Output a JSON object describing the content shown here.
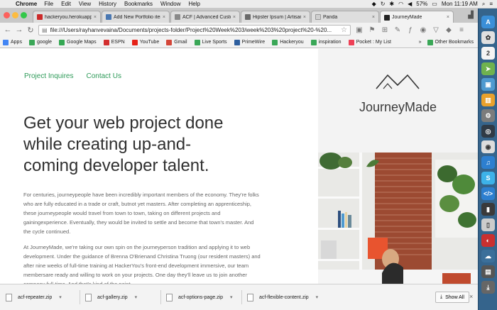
{
  "menubar": {
    "app_name": "Chrome",
    "items": [
      "File",
      "Edit",
      "View",
      "History",
      "Bookmarks",
      "Window",
      "Help"
    ],
    "battery": "57%",
    "clock": "Mon 11:19 AM"
  },
  "tabs": [
    {
      "title": "hackeryou.herokuapp.c",
      "icon_color": "#cc2a2a",
      "active": false
    },
    {
      "title": "Add New Portfolio item",
      "icon_color": "#4a78b2",
      "active": false
    },
    {
      "title": "ACF | Advanced Custom",
      "icon_color": "#8a8a8a",
      "active": false
    },
    {
      "title": "Hipster Ipsum | Artisan",
      "icon_color": "#6a6a6a",
      "active": false
    },
    {
      "title": "Panda",
      "icon_color": "#cfcfcf",
      "active": false
    },
    {
      "title": "JourneyMade",
      "icon_color": "#222222",
      "active": true
    }
  ],
  "toolbar": {
    "url": "file:///Users/rayhanvevaina/Documents/projects-folder/Project%20Week%203/week%203%20project%20-%20..."
  },
  "bookmarks": {
    "items": [
      {
        "label": "Apps",
        "icon": "apps-grid-icon",
        "color": "#4285f4"
      },
      {
        "label": "google",
        "icon": "folder-icon",
        "color": "#3aa757"
      },
      {
        "label": "Google Maps",
        "icon": "maps-pin-icon",
        "color": "#34a853"
      },
      {
        "label": "ESPN",
        "icon": "espn-icon",
        "color": "#d32f2f"
      },
      {
        "label": "YouTube",
        "icon": "youtube-icon",
        "color": "#e62117"
      },
      {
        "label": "Gmail",
        "icon": "gmail-icon",
        "color": "#d44638"
      },
      {
        "label": "Live Sports",
        "icon": "folder-icon",
        "color": "#3aa757"
      },
      {
        "label": "PrimeWire",
        "icon": "primewire-icon",
        "color": "#2d5e9e"
      },
      {
        "label": "Hackeryou",
        "icon": "folder-icon",
        "color": "#3aa757"
      },
      {
        "label": "inspiration",
        "icon": "folder-icon",
        "color": "#3aa757"
      },
      {
        "label": "Pocket : My List",
        "icon": "pocket-icon",
        "color": "#ee4056"
      }
    ],
    "overflow": "»",
    "other": "Other Bookmarks"
  },
  "page": {
    "nav": [
      "Project Inquires",
      "Contact Us"
    ],
    "headline": "Get your web project done while creating up-and-coming developer talent.",
    "paragraphs": [
      "For centuries, journeypeople have been incredibly important members of the economy. They're folks who are fully educated in a trade or craft, butnot yet masters. After completing an apprenticeship, these journeypeople would travel from town to town, taking on different projects and gainingexperience. Eventually, they would be invited to settle and become that town's master. And the cycle continued.",
      "At JourneyMade, we're taking our own spin on the journeyperson tradition and applying it to web development. Under the guidance of Brenna O'Brienand Christina Truong (our resident masters) and after nine weeks of full-time training at HackerYou's front-end development immersive, our team membersare ready and willing to work on your projects. One day they'll leave us to join another company full-time. And that's kind of the point."
    ],
    "brand": "JourneyMade"
  },
  "downloads": {
    "files": [
      "acf-repeater.zip",
      "acf-gallery.zip",
      "acf-options-page.zip",
      "acf-flexible-content.zip"
    ],
    "show_all": "Show All"
  },
  "colors": {
    "accent_green": "#2d9a58",
    "headline": "#303030",
    "body_text": "#666666"
  }
}
